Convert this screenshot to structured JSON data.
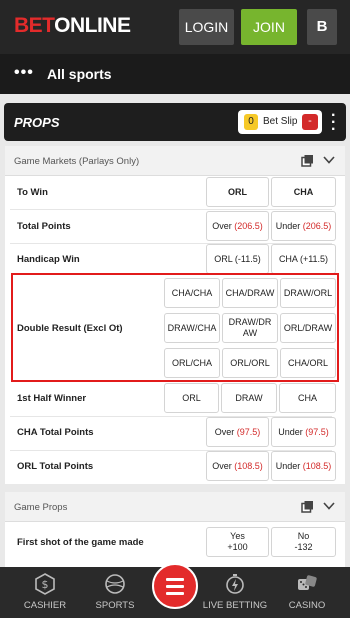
{
  "header": {
    "logo_bet": "BET",
    "logo_online": "ONLINE",
    "login_label": "LOGIN",
    "join_label": "JOIN",
    "account_label": "B"
  },
  "nav": {
    "menu_label": "•••",
    "title": "All sports"
  },
  "props": {
    "title": "PROPS",
    "betslip_count": "0",
    "betslip_label": "Bet Slip",
    "betslip_minus": "-"
  },
  "game_markets": {
    "title": "Game Markets (Parlays Only)",
    "to_win": {
      "label": "To Win",
      "opt1": "ORL",
      "opt2": "CHA"
    },
    "total_points": {
      "label": "Total Points",
      "opt1_label": "Over",
      "opt1_val": "(206.5)",
      "opt2_label": "Under",
      "opt2_val": "(206.5)"
    },
    "handicap_win": {
      "label": "Handicap Win",
      "opt1": "ORL (-11.5)",
      "opt2": "CHA (+11.5)"
    },
    "double_result": {
      "label": "Double Result (Excl Ot)",
      "options": [
        "CHA/CHA",
        "CHA/DRAW",
        "DRAW/ORL",
        "DRAW/CHA",
        "DRAW/DRAW",
        "ORL/DRAW",
        "ORL/CHA",
        "ORL/ORL",
        "CHA/ORL"
      ]
    },
    "first_half": {
      "label": "1st Half Winner",
      "opt1": "ORL",
      "opt2": "DRAW",
      "opt3": "CHA"
    },
    "cha_total": {
      "label": "CHA Total Points",
      "opt1_label": "Over",
      "opt1_val": "(97.5)",
      "opt2_label": "Under",
      "opt2_val": "(97.5)"
    },
    "orl_total": {
      "label": "ORL Total Points",
      "opt1_label": "Over",
      "opt1_val": "(108.5)",
      "opt2_label": "Under",
      "opt2_val": "(108.5)"
    }
  },
  "game_props": {
    "title": "Game Props",
    "first_shot": {
      "label": "First shot of the game made",
      "opt1_label": "Yes",
      "opt1_val": "+100",
      "opt2_label": "No",
      "opt2_val": "-132"
    }
  },
  "bottom_nav": {
    "cashier": "CASHIER",
    "sports": "SPORTS",
    "live": "LIVE BETTING",
    "casino": "CASINO"
  },
  "colors": {
    "brand_red": "#e32b2b",
    "join_green": "#77b52e",
    "odds_red": "#d32a2a",
    "highlight": "#e21b1b"
  }
}
